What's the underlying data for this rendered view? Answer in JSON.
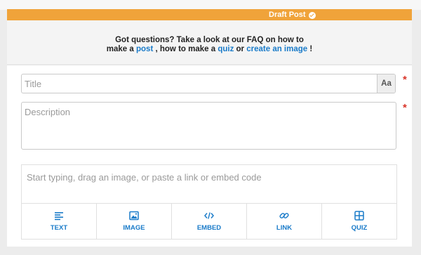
{
  "banner": {
    "status": "Draft Post"
  },
  "faq": {
    "line1": "Got questions? Take a look at our FAQ on how to",
    "line2_prefix": "make a",
    "post_link": "post",
    "mid1": ", how to make a",
    "quiz_link": "quiz",
    "mid2": "or",
    "image_link": "create an image",
    "suffix": "!"
  },
  "form": {
    "title_placeholder": "Title",
    "format_button": "Aa",
    "description_placeholder": "Description",
    "required_mark": "*",
    "editor_placeholder": "Start typing, drag an image, or paste a link or embed code"
  },
  "tools": [
    {
      "label": "TEXT",
      "icon": "text-lines-icon"
    },
    {
      "label": "IMAGE",
      "icon": "image-icon"
    },
    {
      "label": "EMBED",
      "icon": "code-icon"
    },
    {
      "label": "LINK",
      "icon": "link-icon"
    },
    {
      "label": "QUIZ",
      "icon": "grid-icon"
    }
  ],
  "colors": {
    "banner": "#f0a33a",
    "link": "#1a7bc9",
    "required": "#d9362b"
  }
}
